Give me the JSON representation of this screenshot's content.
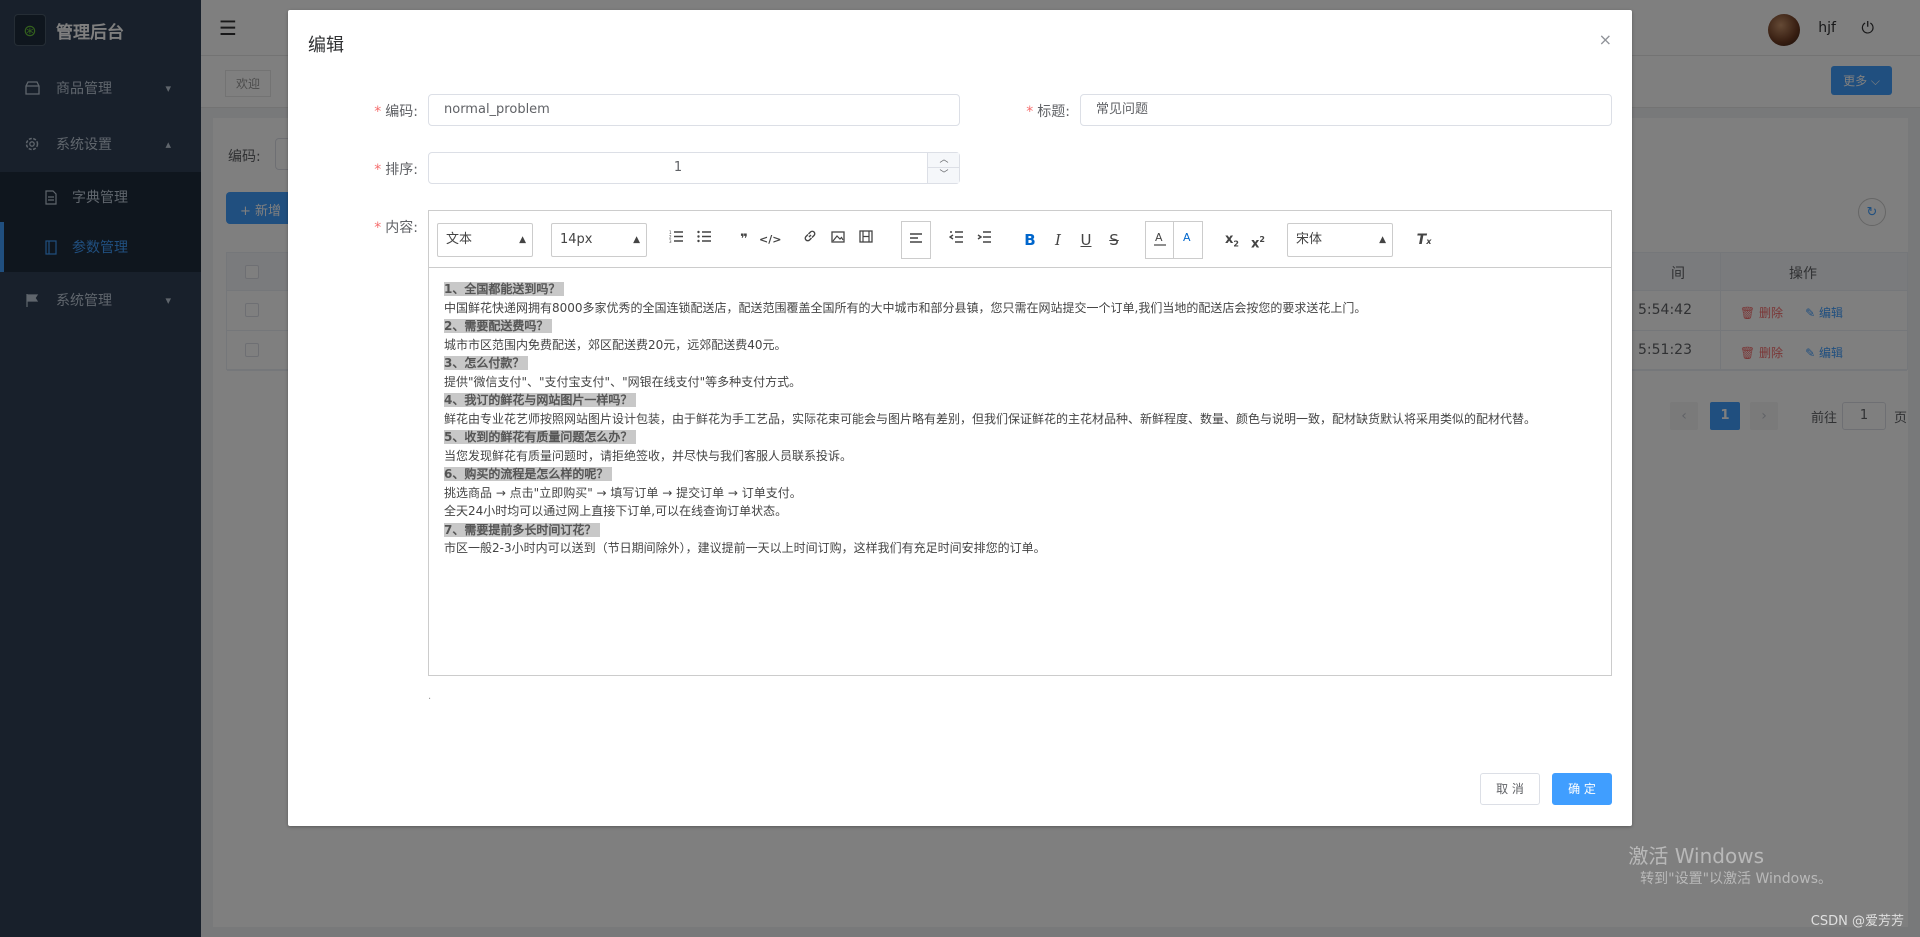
{
  "app": {
    "title": "管理后台",
    "logo_icon": "app-logo-icon"
  },
  "sidebar": {
    "items": [
      {
        "label": "商品管理",
        "icon": "goods-icon",
        "arrow": "▾"
      },
      {
        "label": "系统设置",
        "icon": "gear-icon",
        "arrow": "▴"
      },
      {
        "label": "系统管理",
        "icon": "flag-icon",
        "arrow": "▾"
      }
    ],
    "sub_items": [
      {
        "label": "字典管理",
        "icon": "document-icon",
        "active": false
      },
      {
        "label": "参数管理",
        "icon": "book-icon",
        "active": true
      }
    ],
    "active_color": "#409eff"
  },
  "header": {
    "menu_icon": "☰",
    "username": "hjf",
    "power_icon": "⏻",
    "tag": "欢迎",
    "more_label": "更多 ⌵"
  },
  "filter": {
    "code_label": "编码:"
  },
  "list": {
    "add_label": "+ 新增",
    "columns": {
      "op": "操作",
      "time": "间"
    },
    "rows": [
      {
        "time": "5:54:42",
        "delete": "删除",
        "edit": "编辑"
      },
      {
        "time": "5:51:23",
        "delete": "删除",
        "edit": "编辑"
      }
    ]
  },
  "pagination": {
    "prev": "‹",
    "current": "1",
    "next": "›",
    "goto_label": "前往",
    "goto_value": "1",
    "page_label": "页"
  },
  "dialog": {
    "title": "编辑",
    "close_icon": "×",
    "fields": {
      "code": {
        "label": "编码:",
        "value": "normal_problem"
      },
      "title": {
        "label": "标题:",
        "value": "常见问题"
      },
      "sort": {
        "label": "排序:",
        "value": "1"
      },
      "content": {
        "label": "内容:"
      }
    },
    "toolbar": {
      "header_select": "文本",
      "size_select": "14px",
      "font_select": "宋体",
      "buttons": [
        "ordered-list",
        "bullet-list",
        "blockquote",
        "code-block",
        "link",
        "image",
        "video",
        "align",
        "indent-decrease",
        "indent-increase",
        "bold",
        "italic",
        "underline",
        "strike",
        "font-color",
        "background-color",
        "subscript",
        "superscript",
        "clear-format"
      ]
    },
    "content": [
      {
        "q": "1、全国都能送到吗？",
        "a": [
          "中国鲜花快递网拥有8000多家优秀的全国连锁配送店，配送范围覆盖全国所有的大中城市和部分县镇，您只需在网站提交一个订单,我们当地的配送店会按您的要求送花上门。"
        ]
      },
      {
        "q": "2、需要配送费吗？",
        "a": [
          "城市市区范围内免费配送，郊区配送费20元，远郊配送费40元。"
        ]
      },
      {
        "q": "3、怎么付款？",
        "a": [
          "提供\"微信支付\"、\"支付宝支付\"、\"网银在线支付\"等多种支付方式。"
        ]
      },
      {
        "q": "4、我订的鲜花与网站图片一样吗？",
        "a": [
          "鲜花由专业花艺师按照网站图片设计包装，由于鲜花为手工艺品，实际花束可能会与图片略有差别，但我们保证鲜花的主花材品种、新鲜程度、数量、颜色与说明一致，配材缺货默认将采用类似的配材代替。"
        ]
      },
      {
        "q": "5、收到的鲜花有质量问题怎么办？",
        "a": [
          "当您发现鲜花有质量问题时，请拒绝签收，并尽快与我们客服人员联系投诉。"
        ]
      },
      {
        "q": "6、购买的流程是怎么样的呢？",
        "a": [
          "挑选商品 → 点击\"立即购买\" → 填写订单 → 提交订单 → 订单支付。",
          "全天24小时均可以通过网上直接下订单,可以在线查询订单状态。"
        ]
      },
      {
        "q": "7、需要提前多长时间订花？",
        "a": [
          "市区一般2-3小时内可以送到（节日期间除外），建议提前一天以上时间订购，这样我们有充足时间安排您的订单。"
        ]
      }
    ],
    "cancel_label": "取 消",
    "ok_label": "确 定"
  },
  "watermark": {
    "line1": "激活 Windows",
    "line2": "转到\"设置\"以激活 Windows。"
  },
  "csdn_mark": "CSDN @爱芳芳"
}
